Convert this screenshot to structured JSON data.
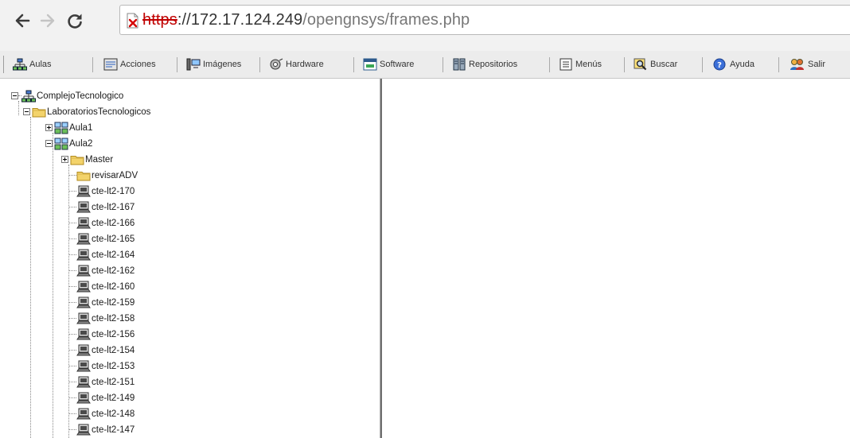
{
  "address_bar": {
    "url_scheme": "https",
    "url_host": "://172.17.124.249",
    "url_path": "/opengnsys/frames.php"
  },
  "toolbar": {
    "items": [
      {
        "label": "Aulas",
        "icon": "classrooms-icon"
      },
      {
        "label": "Acciones",
        "icon": "actions-icon"
      },
      {
        "label": "Imágenes",
        "icon": "images-icon"
      },
      {
        "label": "Hardware",
        "icon": "hardware-icon"
      },
      {
        "label": "Software",
        "icon": "software-icon"
      },
      {
        "label": "Repositorios",
        "icon": "repositories-icon"
      },
      {
        "label": "Menús",
        "icon": "menus-icon"
      },
      {
        "label": "Buscar",
        "icon": "search-icon"
      },
      {
        "label": "Ayuda",
        "icon": "help-icon"
      },
      {
        "label": "Salir",
        "icon": "exit-icon"
      }
    ]
  },
  "tree": {
    "root": "ComplejoTecnologico",
    "group": "LaboratoriosTecnologicos",
    "classrooms": [
      "Aula1",
      "Aula2"
    ],
    "aula2_folders": [
      "Master",
      "revisarADV"
    ],
    "computers": [
      "cte-lt2-170",
      "cte-lt2-167",
      "cte-lt2-166",
      "cte-lt2-165",
      "cte-lt2-164",
      "cte-lt2-162",
      "cte-lt2-160",
      "cte-lt2-159",
      "cte-lt2-158",
      "cte-lt2-156",
      "cte-lt2-154",
      "cte-lt2-153",
      "cte-lt2-151",
      "cte-lt2-149",
      "cte-lt2-148",
      "cte-lt2-147"
    ]
  },
  "colors": {
    "insecure_scheme": "#c00000",
    "frame_divider": "#6f6f6f"
  }
}
